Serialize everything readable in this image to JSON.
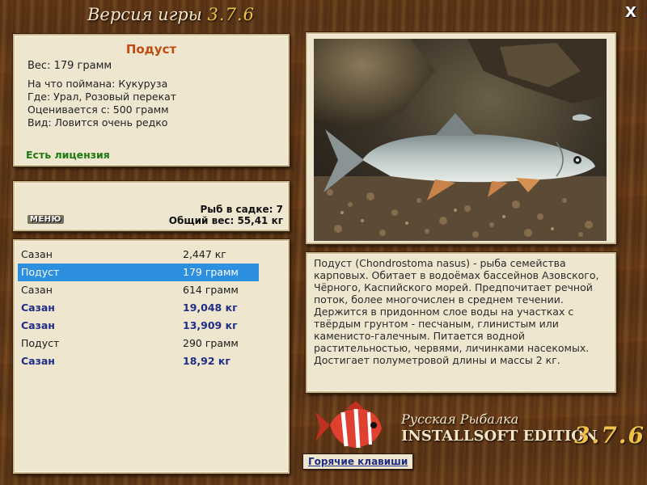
{
  "window": {
    "title": "Версия игры",
    "version": "3.7.6",
    "close_label": "X"
  },
  "fish_info": {
    "name": "Подуст",
    "weight": "Вес: 179 грамм",
    "lines": [
      "На что поймана: Кукуруза",
      "Где: Урал, Розовый перекат",
      "Оценивается с: 500 грамм",
      "Вид: Ловится очень редко"
    ],
    "license": "Есть лицензия"
  },
  "summary": {
    "menu_label": "МЕНЮ",
    "fish_in_keepnet": "Рыб в садке: 7",
    "total_weight": "Общий вес: 55,41 кг"
  },
  "catch_list": [
    {
      "name": "Сазан",
      "weight": "2,447 кг",
      "style": "normal"
    },
    {
      "name": "Подуст",
      "weight": "179 грамм",
      "style": "selected"
    },
    {
      "name": "Сазан",
      "weight": "614 грамм",
      "style": "normal"
    },
    {
      "name": "Сазан",
      "weight": "19,048 кг",
      "style": "bold"
    },
    {
      "name": "Сазан",
      "weight": "13,909 кг",
      "style": "bold"
    },
    {
      "name": "Подуст",
      "weight": "290 грамм",
      "style": "normal"
    },
    {
      "name": "Сазан",
      "weight": "18,92 кг",
      "style": "bold"
    }
  ],
  "description": "Подуст (Chondrostoma nasus) - рыба семейства карповых. Обитает в водоёмах бассейнов Азовского, Чёрного, Каспийского морей. Предпочитает речной поток, более многочислен в среднем течении. Держится в придонном слое воды на участках с твёрдым грунтом - песчаным, глинистым или каменисто-галечным. Питается водной растительностью, червями, личинками насекомых. Достигает полуметровой длины и массы 2 кг.",
  "logo": {
    "line1": "Русская Рыбалка",
    "line2": "INSTALLSOFT EDITION",
    "version": "3.7.6"
  },
  "hotkeys_label": "Горячие клавиши",
  "colors": {
    "fish_name": "#c04a10",
    "license": "#1f7a12",
    "selected_row": "#2d8fe0",
    "bold_row": "#1f2d86",
    "version_gold": "#f0c24a"
  }
}
